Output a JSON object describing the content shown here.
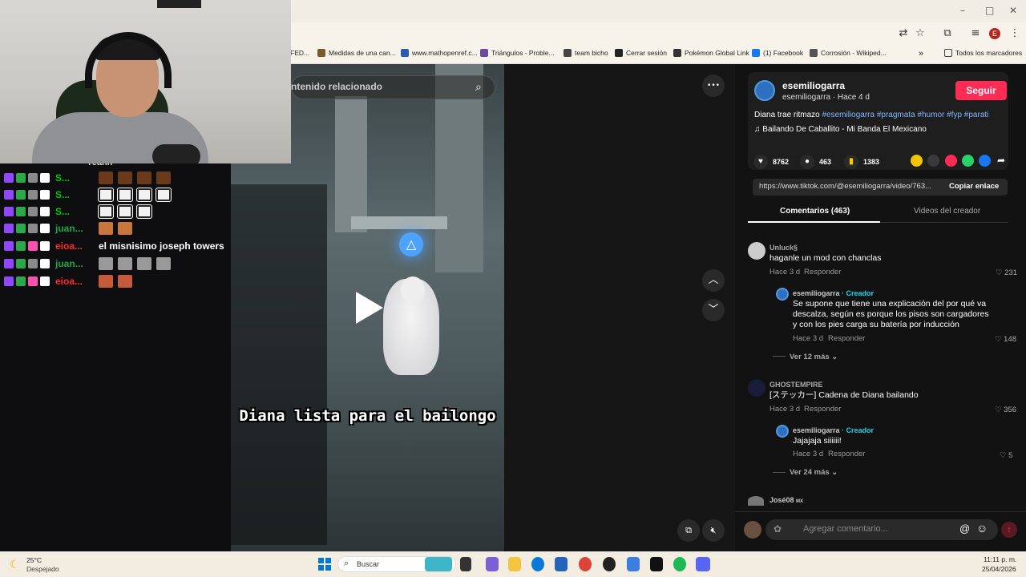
{
  "browser": {
    "window_controls": [
      "–",
      "□",
      "✕"
    ],
    "profile_initial": "E",
    "bookmarks": [
      {
        "label": "FED...",
        "color": "#cfcfcf"
      },
      {
        "label": "Medidas de una can...",
        "color": "#7a5a2a"
      },
      {
        "label": "www.mathopenref.c...",
        "color": "#2a5db0"
      },
      {
        "label": "Triángulos - Proble...",
        "color": "#6b4ca5"
      },
      {
        "label": "team bicho",
        "color": "#444444"
      },
      {
        "label": "Cerrar sesión",
        "color": "#222222"
      },
      {
        "label": "Pokémon Global Link",
        "color": "#333333"
      },
      {
        "label": "(1) Facebook",
        "color": "#1877f2"
      },
      {
        "label": "Corrosión - Wikiped...",
        "color": "#555555"
      }
    ],
    "bookmarks_more": "»",
    "all_bookmarks": "Todos los marcadores"
  },
  "chat": {
    "partial_top": "Yeahh",
    "messages": [
      {
        "user": "S...",
        "color": "#00c800",
        "badge": "#9146ff",
        "emotes": 4,
        "emote_color": "#6a3a1a",
        "text": ""
      },
      {
        "user": "S...",
        "color": "#00c800",
        "badge": "#9146ff",
        "emotes": 4,
        "emote_color": "#f2f2f2",
        "text": ""
      },
      {
        "user": "S...",
        "color": "#00c800",
        "badge": "#9146ff",
        "emotes": 3,
        "emote_color": "#f2f2f2",
        "text": ""
      },
      {
        "user": "juan...",
        "color": "#1aa84a",
        "badge": "#9146ff",
        "emotes": 2,
        "emote_color": "#c8763c",
        "text": ""
      },
      {
        "user": "eioa...",
        "color": "#ff2a2a",
        "badge": "#9146ff",
        "emotes": 0,
        "emote_color": "",
        "text": "el misnisimo joseph towers"
      },
      {
        "user": "juan...",
        "color": "#1aa84a",
        "badge": "#9146ff",
        "emotes": 4,
        "emote_color": "#9a9a9a",
        "text": ""
      },
      {
        "user": "eioa...",
        "color": "#ff2a2a",
        "badge": "#9146ff",
        "emotes": 2,
        "emote_color": "#c85a3c",
        "text": ""
      }
    ]
  },
  "video": {
    "search_placeholder": "ntenido relacionado",
    "caption": "Diana lista para el bailongo",
    "ps_symbol": "△",
    "more_icon": "•••",
    "up_icon": "︿",
    "down_icon": "﹀"
  },
  "post": {
    "author": "esemiliogarra",
    "subtitle": "esemiliogarra · Hace 4 d",
    "follow_label": "Seguir",
    "description_prefix": "Diana trae ritmazo ",
    "hashtags": "#esemiliogarra #pragmata #humor #fyp #parati",
    "music": "Bailando De Caballito - Mi Banda El Mexicano",
    "likes": "8762",
    "comments": "463",
    "saves": "1383",
    "link": "https://www.tiktok.com/@esemiliogarra/video/763...",
    "copy_label": "Copiar enlace",
    "tabs": [
      "Comentarios (463)",
      "Videos del creador"
    ]
  },
  "comments": [
    {
      "name": "Unluck§",
      "text": [
        "haganle un mod con chanclas"
      ],
      "meta": "Hace 3 d",
      "reply": "Responder",
      "likes": "231"
    },
    {
      "name": "esemiliogarra",
      "creator": "· Creador",
      "text": [
        "Se supone que tiene una explicación del por qué va",
        "descalza, según es porque los pisos son cargadores",
        "y con los pies carga su batería por inducción"
      ],
      "meta": "Hace 3 d",
      "reply": "Responder",
      "likes": "148"
    },
    {
      "more": "Ver 12 más"
    },
    {
      "name": "GHOSTEMPIRE",
      "text": [
        "[ステッカー] Cadena de Diana bailando"
      ],
      "meta": "Hace 3 d",
      "reply": "Responder",
      "likes": "356"
    },
    {
      "name": "esemiliogarra",
      "creator": "· Creador",
      "text": [
        "Jajajaja siiiiii!"
      ],
      "meta": "Hace 3 d",
      "reply": "Responder",
      "likes": "5"
    },
    {
      "more": "Ver 24 más"
    },
    {
      "name": "José08",
      "suffix": "MX"
    }
  ],
  "comment_input": {
    "placeholder": "Agregar comentario..."
  },
  "taskbar": {
    "temp": "25°C",
    "weather": "Despejado",
    "search": "Buscar",
    "time": "11:11 p. m.",
    "date": "25/04/2026"
  }
}
